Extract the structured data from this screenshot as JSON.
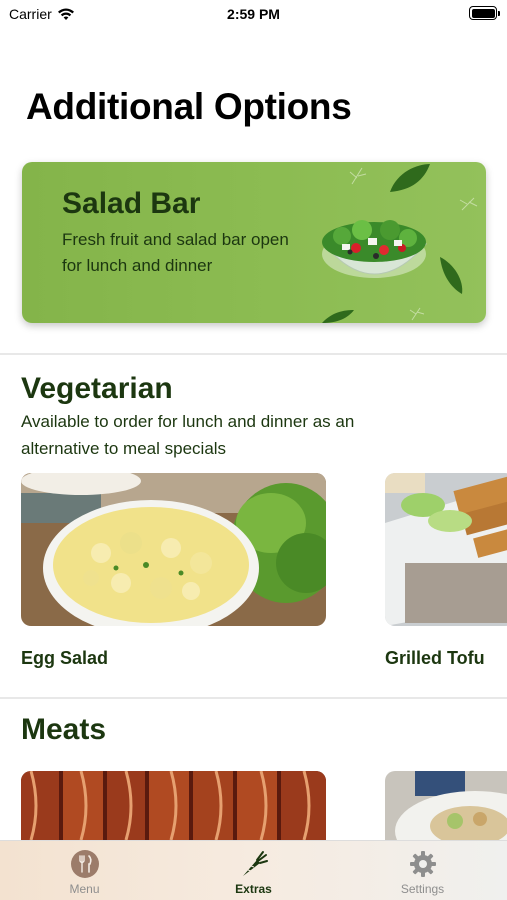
{
  "status_bar": {
    "carrier": "Carrier",
    "time": "2:59 PM"
  },
  "page": {
    "title": "Additional Options"
  },
  "salad_bar": {
    "title": "Salad Bar",
    "description": "Fresh fruit and salad bar open for lunch and dinner"
  },
  "vegetarian": {
    "title": "Vegetarian",
    "description": "Available to order for lunch and dinner as an alternative to meal specials",
    "items": [
      {
        "label": "Egg Salad"
      },
      {
        "label": "Grilled Tofu"
      }
    ]
  },
  "meats": {
    "title": "Meats"
  },
  "tab_bar": {
    "tabs": [
      {
        "label": "Menu",
        "icon": "fork-knife-icon",
        "active": false
      },
      {
        "label": "Extras",
        "icon": "carrot-icon",
        "active": true
      },
      {
        "label": "Settings",
        "icon": "gear-icon",
        "active": false
      }
    ]
  },
  "colors": {
    "brand_green": "#1c3710",
    "card_green": "#8cbc52",
    "inactive_gray": "#8e8e8e"
  }
}
